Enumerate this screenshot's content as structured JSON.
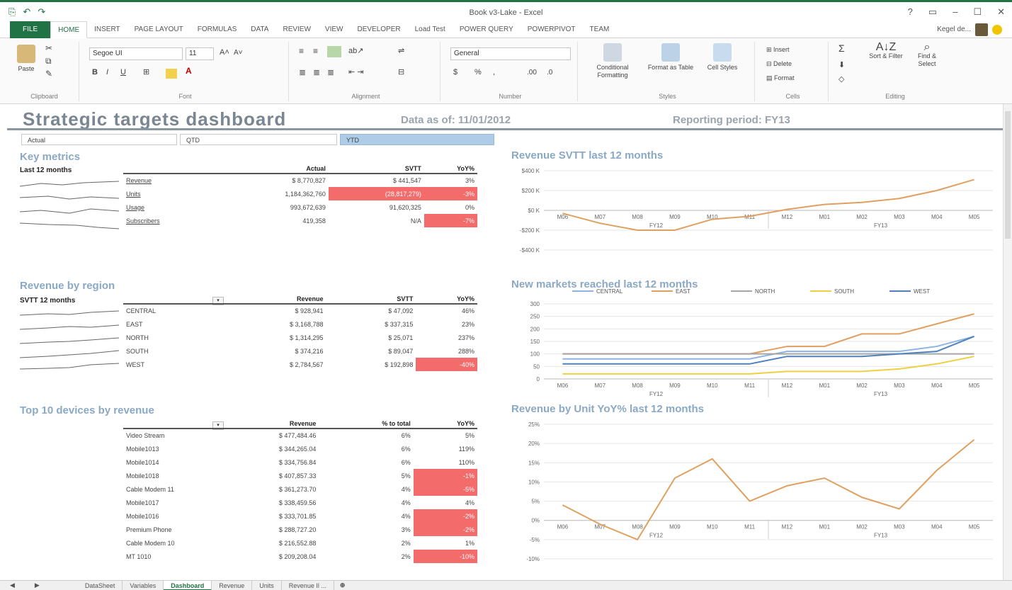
{
  "titlebar": {
    "title": "Book v3-Lake - Excel",
    "undo": "↶",
    "redo": "↷",
    "save": "⎘"
  },
  "ribbon_tabs": [
    "FILE",
    "HOME",
    "INSERT",
    "PAGE LAYOUT",
    "FORMULAS",
    "DATA",
    "REVIEW",
    "VIEW",
    "DEVELOPER",
    "Load Test",
    "POWER QUERY",
    "POWERPIVOT",
    "TEAM"
  ],
  "user_name": "Kegel de...",
  "ribbon": {
    "clipboard": {
      "label": "Clipboard",
      "paste": "Paste"
    },
    "font": {
      "label": "Font",
      "family": "Segoe UI",
      "size": "11",
      "bold": "B",
      "italic": "I",
      "underline": "U"
    },
    "alignment": {
      "label": "Alignment"
    },
    "number": {
      "label": "Number",
      "format": "General",
      "currency": "$",
      "percent": "%",
      "comma": ","
    },
    "styles": {
      "label": "Styles",
      "cond": "Conditional Formatting",
      "table": "Format as Table",
      "cell": "Cell Styles"
    },
    "cells": {
      "label": "Cells",
      "insert": "Insert",
      "delete": "Delete",
      "format": "Format"
    },
    "editing": {
      "label": "Editing",
      "sort": "Sort & Filter",
      "find": "Find & Select",
      "sum": "Σ"
    }
  },
  "dashboard": {
    "title": "Strategic targets dashboard",
    "data_as_of": "Data as of: 11/01/2012",
    "reporting_period": "Reporting period: FY13",
    "slicers": [
      "Actual",
      "QTD",
      "YTD"
    ]
  },
  "key_metrics": {
    "title": "Key metrics",
    "subtitle": "Last 12 months",
    "headers": [
      "",
      "Actual",
      "SVTT",
      "YoY%"
    ],
    "rows": [
      {
        "label": "Revenue",
        "actual": "$ 8,770,827",
        "svtt": "$ 441,547",
        "yoy": "3%",
        "svtt_red": false,
        "yoy_red": false
      },
      {
        "label": "Units",
        "actual": "1,184,362,760",
        "svtt": "(28,817,279)",
        "yoy": "-3%",
        "svtt_red": true,
        "yoy_red": true
      },
      {
        "label": "Usage",
        "actual": "993,672,639",
        "svtt": "91,620,325",
        "yoy": "0%",
        "svtt_red": false,
        "yoy_red": false
      },
      {
        "label": "Subscribers",
        "actual": "419,358",
        "svtt": "N/A",
        "yoy": "-7%",
        "svtt_red": false,
        "yoy_red": true
      }
    ]
  },
  "revenue_region": {
    "title": "Revenue by region",
    "subtitle": "SVTT 12 months",
    "headers": [
      "",
      "Revenue",
      "SVTT",
      "YoY%"
    ],
    "rows": [
      {
        "label": "CENTRAL",
        "revenue": "$ 928,941",
        "svtt": "$ 47,092",
        "yoy": "46%",
        "yoy_red": false
      },
      {
        "label": "EAST",
        "revenue": "$ 3,168,788",
        "svtt": "$ 337,315",
        "yoy": "23%",
        "yoy_red": false
      },
      {
        "label": "NORTH",
        "revenue": "$ 1,314,295",
        "svtt": "$ 25,071",
        "yoy": "237%",
        "yoy_red": false
      },
      {
        "label": "SOUTH",
        "revenue": "$ 374,216",
        "svtt": "$ 89,047",
        "yoy": "288%",
        "yoy_red": false
      },
      {
        "label": "WEST",
        "revenue": "$ 2,784,567",
        "svtt": "$ 192,898",
        "yoy": "-40%",
        "yoy_red": true
      }
    ]
  },
  "top_devices": {
    "title": "Top 10 devices by revenue",
    "headers": [
      "",
      "Revenue",
      "% to total",
      "YoY%"
    ],
    "rows": [
      {
        "label": "Video Stream",
        "revenue": "$ 477,484.46",
        "pct": "6%",
        "yoy": "5%",
        "yoy_red": false
      },
      {
        "label": "Mobile1013",
        "revenue": "$ 344,265.04",
        "pct": "6%",
        "yoy": "119%",
        "yoy_red": false
      },
      {
        "label": "Mobile1014",
        "revenue": "$ 334,756.84",
        "pct": "6%",
        "yoy": "110%",
        "yoy_red": false
      },
      {
        "label": "Mobile1018",
        "revenue": "$ 407,857.33",
        "pct": "5%",
        "yoy": "-1%",
        "yoy_red": true
      },
      {
        "label": "Cable Modem 11",
        "revenue": "$ 361,273.70",
        "pct": "4%",
        "yoy": "-5%",
        "yoy_red": true
      },
      {
        "label": "Mobile1017",
        "revenue": "$ 338,459.56",
        "pct": "4%",
        "yoy": "4%",
        "yoy_red": false
      },
      {
        "label": "Mobile1016",
        "revenue": "$ 333,701.85",
        "pct": "4%",
        "yoy": "-2%",
        "yoy_red": true
      },
      {
        "label": "Premium Phone",
        "revenue": "$ 288,727.20",
        "pct": "3%",
        "yoy": "-2%",
        "yoy_red": true
      },
      {
        "label": "Cable Modem 10",
        "revenue": "$ 216,552.88",
        "pct": "2%",
        "yoy": "1%",
        "yoy_red": false
      },
      {
        "label": "MT 1010",
        "revenue": "$ 209,208.04",
        "pct": "2%",
        "yoy": "-10%",
        "yoy_red": true
      }
    ]
  },
  "chart_data": [
    {
      "type": "line",
      "title": "Revenue SVTT last 12 months",
      "x": [
        "M06",
        "M07",
        "M08",
        "M09",
        "M10",
        "M11",
        "M12",
        "M01",
        "M02",
        "M03",
        "M04",
        "M05"
      ],
      "groups": [
        "FY12",
        "FY13"
      ],
      "ytick_labels": [
        "$400 K",
        "$200 K",
        "$0 K",
        "-$200 K",
        "-$400 K"
      ],
      "ylim": [
        -400,
        400
      ],
      "series": [
        {
          "values": [
            -30,
            -130,
            -200,
            -200,
            -90,
            -60,
            10,
            60,
            80,
            120,
            200,
            310
          ],
          "color": "#e0a060"
        }
      ]
    },
    {
      "type": "line",
      "title": "New markets reached last 12 months",
      "x": [
        "M06",
        "M07",
        "M08",
        "M09",
        "M10",
        "M11",
        "M12",
        "M01",
        "M02",
        "M03",
        "M04",
        "M05"
      ],
      "groups": [
        "FY12",
        "FY13"
      ],
      "ytick_labels": [
        "300",
        "250",
        "200",
        "150",
        "100",
        "50",
        "0"
      ],
      "ylim": [
        0,
        300
      ],
      "series": [
        {
          "name": "CENTRAL",
          "values": [
            80,
            80,
            80,
            80,
            80,
            80,
            110,
            110,
            110,
            110,
            130,
            170
          ],
          "color": "#8db4e2"
        },
        {
          "name": "EAST",
          "values": [
            100,
            100,
            100,
            100,
            100,
            100,
            130,
            130,
            180,
            180,
            220,
            260
          ],
          "color": "#e0a060"
        },
        {
          "name": "NORTH",
          "values": [
            100,
            100,
            100,
            100,
            100,
            100,
            100,
            100,
            100,
            100,
            100,
            100
          ],
          "color": "#a6a6a6"
        },
        {
          "name": "SOUTH",
          "values": [
            20,
            20,
            20,
            20,
            20,
            20,
            30,
            30,
            30,
            40,
            60,
            90
          ],
          "color": "#f0d040"
        },
        {
          "name": "WEST",
          "values": [
            60,
            60,
            60,
            60,
            60,
            60,
            90,
            90,
            90,
            100,
            110,
            170
          ],
          "color": "#4f81bd"
        }
      ]
    },
    {
      "type": "line",
      "title": "Revenue by Unit YoY% last 12 months",
      "x": [
        "M06",
        "M07",
        "M08",
        "M09",
        "M10",
        "M11",
        "M12",
        "M01",
        "M02",
        "M03",
        "M04",
        "M05"
      ],
      "groups": [
        "FY12",
        "FY13"
      ],
      "ytick_labels": [
        "25%",
        "20%",
        "15%",
        "10%",
        "5%",
        "0%",
        "-5%",
        "-10%"
      ],
      "ylim": [
        -10,
        25
      ],
      "series": [
        {
          "values": [
            4,
            -1,
            -5,
            11,
            16,
            5,
            9,
            11,
            6,
            3,
            13,
            21
          ],
          "color": "#e0a060"
        }
      ]
    }
  ],
  "sheet_tabs": [
    "DataSheet",
    "Variables",
    "Dashboard",
    "Revenue",
    "Units",
    "Revenue Il ..."
  ],
  "sheet_tab_add": "⊕"
}
